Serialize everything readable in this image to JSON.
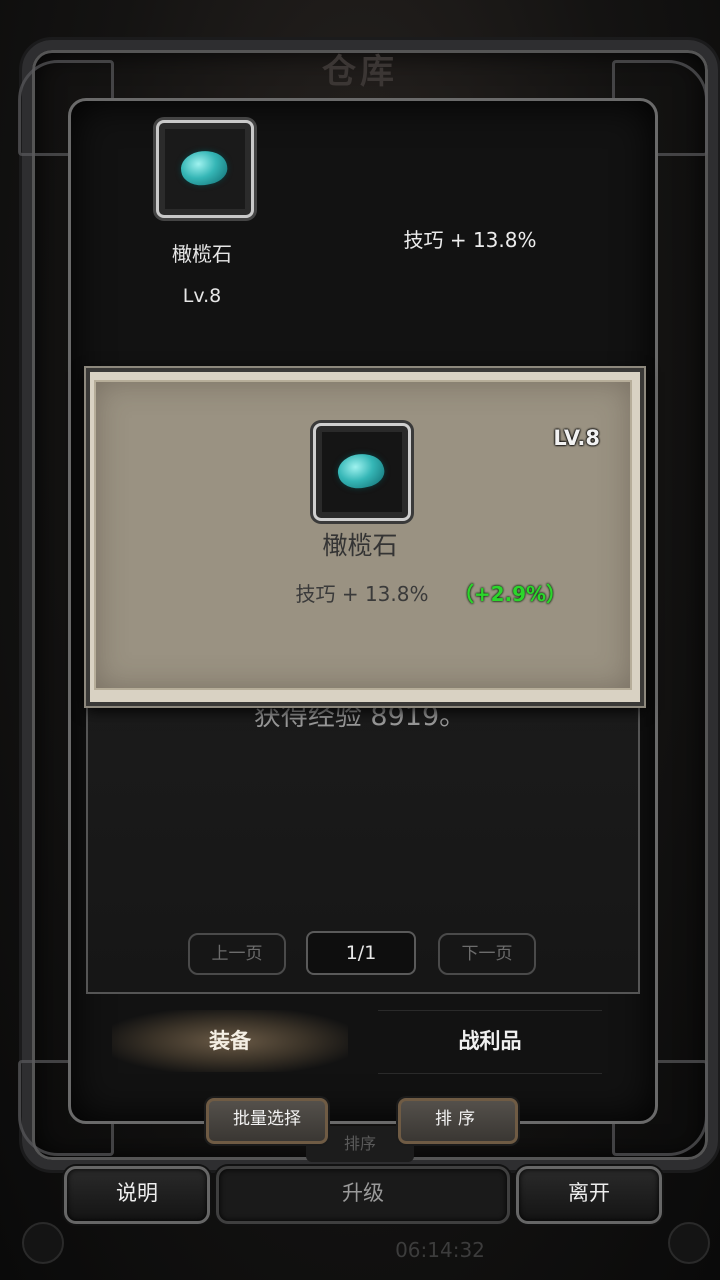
{
  "screen": {
    "title": "仓库"
  },
  "top_item": {
    "name": "橄榄石",
    "level": "Lv.8",
    "stat": "技巧 + 13.8%",
    "icon": "olivine-gem-icon"
  },
  "popup": {
    "level": "LV.8",
    "name": "橄榄石",
    "stat": "技巧 + 13.8%",
    "bonus": "（+2.9%）",
    "bonus_color": "#2bd62b",
    "icon": "olivine-gem-icon"
  },
  "message": "获得经验 8919。",
  "pager": {
    "prev_label": "上一页",
    "next_label": "下一页",
    "page": "1/1"
  },
  "tabs": [
    {
      "label": "装备",
      "active": true
    },
    {
      "label": "战利品",
      "active": false
    }
  ],
  "actions": {
    "batch_select": "批量选择",
    "sort": "排序",
    "sort_behind": "排序"
  },
  "bottom": {
    "help": "说明",
    "upgrade": "升级",
    "leave": "离开",
    "clock": "06:14:32"
  }
}
